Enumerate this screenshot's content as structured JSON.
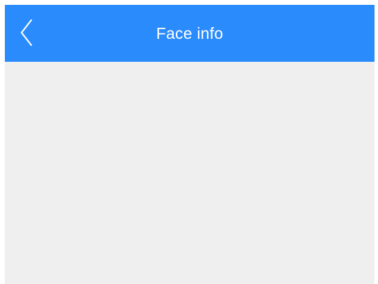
{
  "header": {
    "title": "Face info",
    "back_icon": "chevron-left-icon",
    "background_color": "#2a8bfd",
    "title_color": "#ffffff"
  },
  "content": {
    "background_color": "#efefef"
  }
}
